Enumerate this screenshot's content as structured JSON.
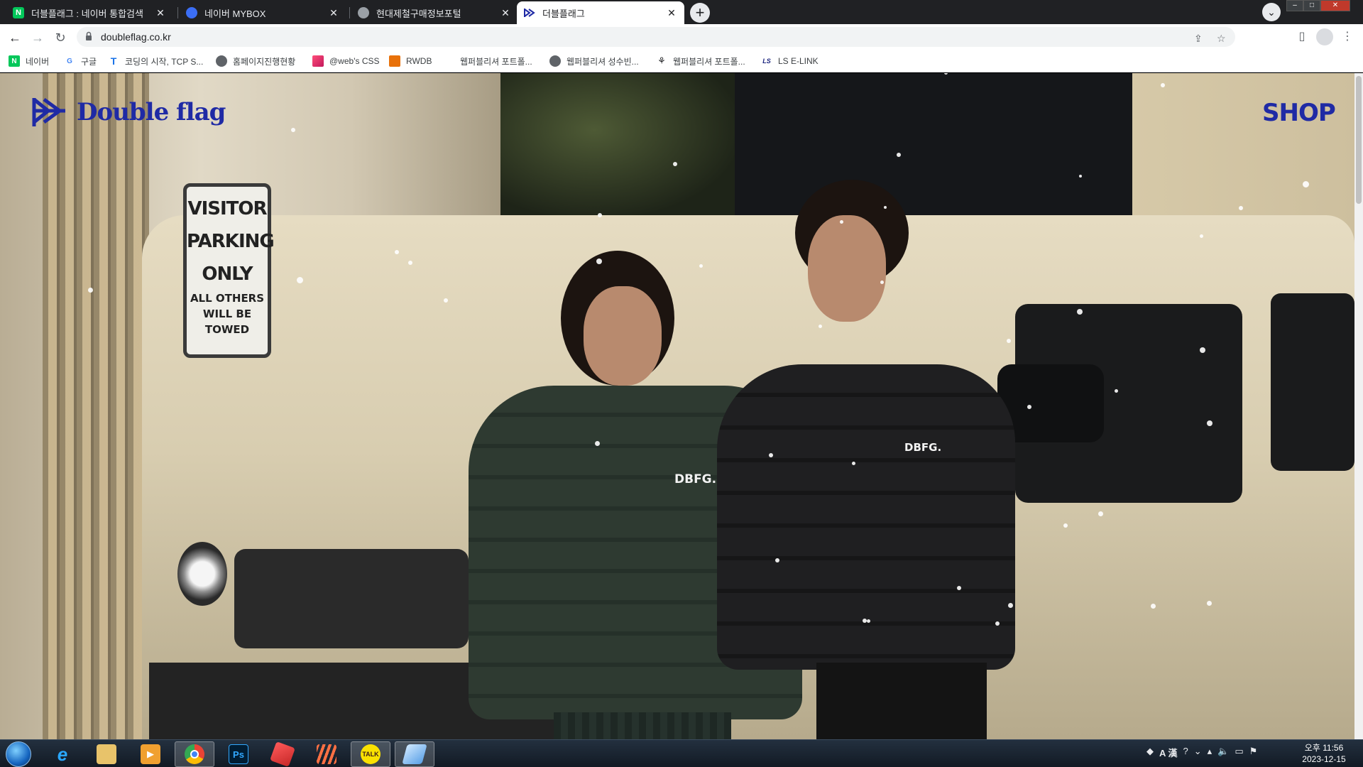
{
  "browser": {
    "tabs": [
      {
        "title": "더블플래그 : 네이버 통합검색",
        "favicon": "naver-icon",
        "active": false
      },
      {
        "title": "네이버 MYBOX",
        "favicon": "mybox-icon",
        "active": false
      },
      {
        "title": "현대제철구매정보포털",
        "favicon": "globe-icon",
        "active": false
      },
      {
        "title": "더블플래그",
        "favicon": "doubleflag-icon",
        "active": true
      }
    ],
    "url": "doubleflag.co.kr",
    "bookmarks": [
      {
        "label": "네이버",
        "icon": "naver-icon"
      },
      {
        "label": "구글",
        "icon": "google-icon"
      },
      {
        "label": "코딩의 시작, TCP S...",
        "icon": "tcp-icon"
      },
      {
        "label": "홈페이지진행현황",
        "icon": "globe-icon"
      },
      {
        "label": "@web's CSS",
        "icon": "css-icon"
      },
      {
        "label": "RWDB",
        "icon": "rwdb-icon"
      },
      {
        "label": "웹퍼블리셔 포트폴...",
        "icon": "blank-icon"
      },
      {
        "label": "웹퍼블리셔 성수빈...",
        "icon": "globe-icon"
      },
      {
        "label": "웹퍼블리셔 포트폴...",
        "icon": "leaf-icon"
      },
      {
        "label": "LS E-LINK",
        "icon": "ls-icon"
      }
    ]
  },
  "site": {
    "brand": "Double flag",
    "nav_shop": "SHOP",
    "brand_color": "#1f2aa5",
    "sign": {
      "line1": "VISITOR",
      "line2": "PARKING",
      "line3": "ONLY",
      "line4": "ALL OTHERS",
      "line5": "WILL BE TOWED"
    },
    "chest_logo": "DBFG."
  },
  "taskbar": {
    "apps": [
      "start-menu",
      "internet-explorer",
      "file-explorer",
      "media-player",
      "chrome",
      "photoshop",
      "app-red",
      "app-stripes",
      "kakaotalk",
      "app-blue"
    ],
    "tray_ime": "A 漢",
    "clock_time": "오후 11:56",
    "clock_date": "2023-12-15"
  }
}
